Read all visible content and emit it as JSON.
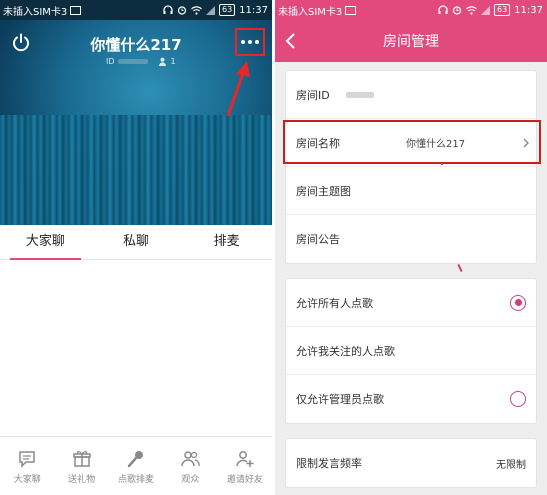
{
  "status_bar": {
    "carrier": "未插入SIM卡3",
    "battery": "63",
    "time": "11:37"
  },
  "live_room": {
    "title": "你懂什么217",
    "id_label": "ID",
    "online_count": "1",
    "tabs": [
      {
        "label": "大家聊",
        "active": true
      },
      {
        "label": "私聊",
        "active": false
      },
      {
        "label": "排麦",
        "active": false
      }
    ],
    "bottom_nav": [
      {
        "label": "大家聊",
        "icon": "chat-bubble-icon"
      },
      {
        "label": "送礼物",
        "icon": "gift-icon"
      },
      {
        "label": "点歌排麦",
        "icon": "microphone-icon"
      },
      {
        "label": "观众",
        "icon": "audience-icon"
      },
      {
        "label": "邀请好友",
        "icon": "add-friend-icon"
      }
    ],
    "colors": {
      "accent": "#e24a7d",
      "highlight_box": "#e82626"
    }
  },
  "room_management": {
    "title": "房间管理",
    "info_group": [
      {
        "label": "房间ID",
        "value": ""
      },
      {
        "label": "房间名称",
        "value": "你懂什么217"
      },
      {
        "label": "房间主题图",
        "value": ""
      },
      {
        "label": "房间公告",
        "value": ""
      }
    ],
    "song_request_group": [
      {
        "label": "允许所有人点歌",
        "checked": true
      },
      {
        "label": "允许我关注的人点歌",
        "checked": false
      },
      {
        "label": "仅允许管理员点歌",
        "checked": false
      }
    ],
    "speech_limit": {
      "label": "限制发言频率",
      "value": "无限制"
    }
  }
}
